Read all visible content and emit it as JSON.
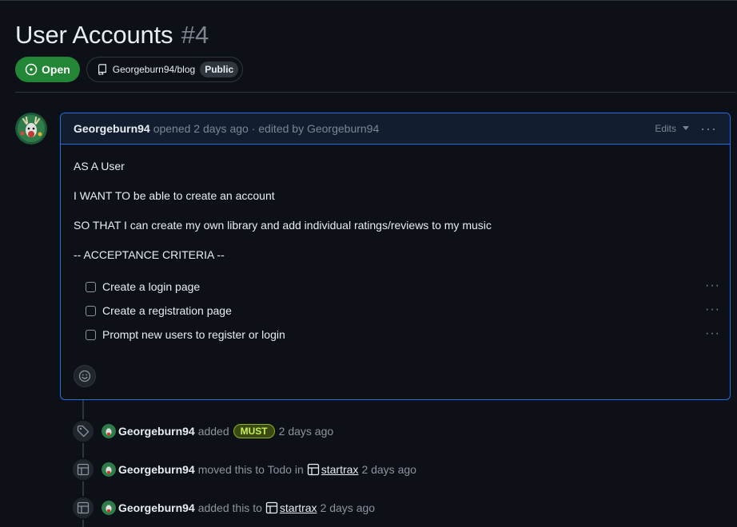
{
  "issue": {
    "title": "User Accounts",
    "number": "#4",
    "state": "Open",
    "repo": "Georgeburn94/blog",
    "visibility": "Public"
  },
  "comment": {
    "author": "Georgeburn94",
    "meta": "opened 2 days ago · edited by Georgeburn94",
    "edits_label": "Edits",
    "paragraphs": [
      "AS A User",
      "I WANT TO be able to create an account",
      "SO THAT I can create my own library and add individual ratings/reviews to my music",
      "-- ACCEPTANCE CRITERIA --"
    ],
    "tasks": [
      {
        "label": "Create a login page",
        "checked": false
      },
      {
        "label": "Create a registration page",
        "checked": false
      },
      {
        "label": "Prompt new users to register or login",
        "checked": false
      }
    ]
  },
  "timeline": [
    {
      "icon": "tag-icon",
      "author": "Georgeburn94",
      "text": "added",
      "label": "MUST",
      "time": "2 days ago"
    },
    {
      "icon": "table-icon",
      "author": "Georgeburn94",
      "text": "moved this to Todo in",
      "project": "startrax",
      "time": "2 days ago"
    },
    {
      "icon": "table-icon",
      "author": "Georgeburn94",
      "text": "added this to",
      "project": "startrax",
      "time": "2 days ago"
    }
  ],
  "colors": {
    "open_green": "#238636",
    "accent_blue": "#1f6feb",
    "label_must": "#c7ef5a"
  }
}
